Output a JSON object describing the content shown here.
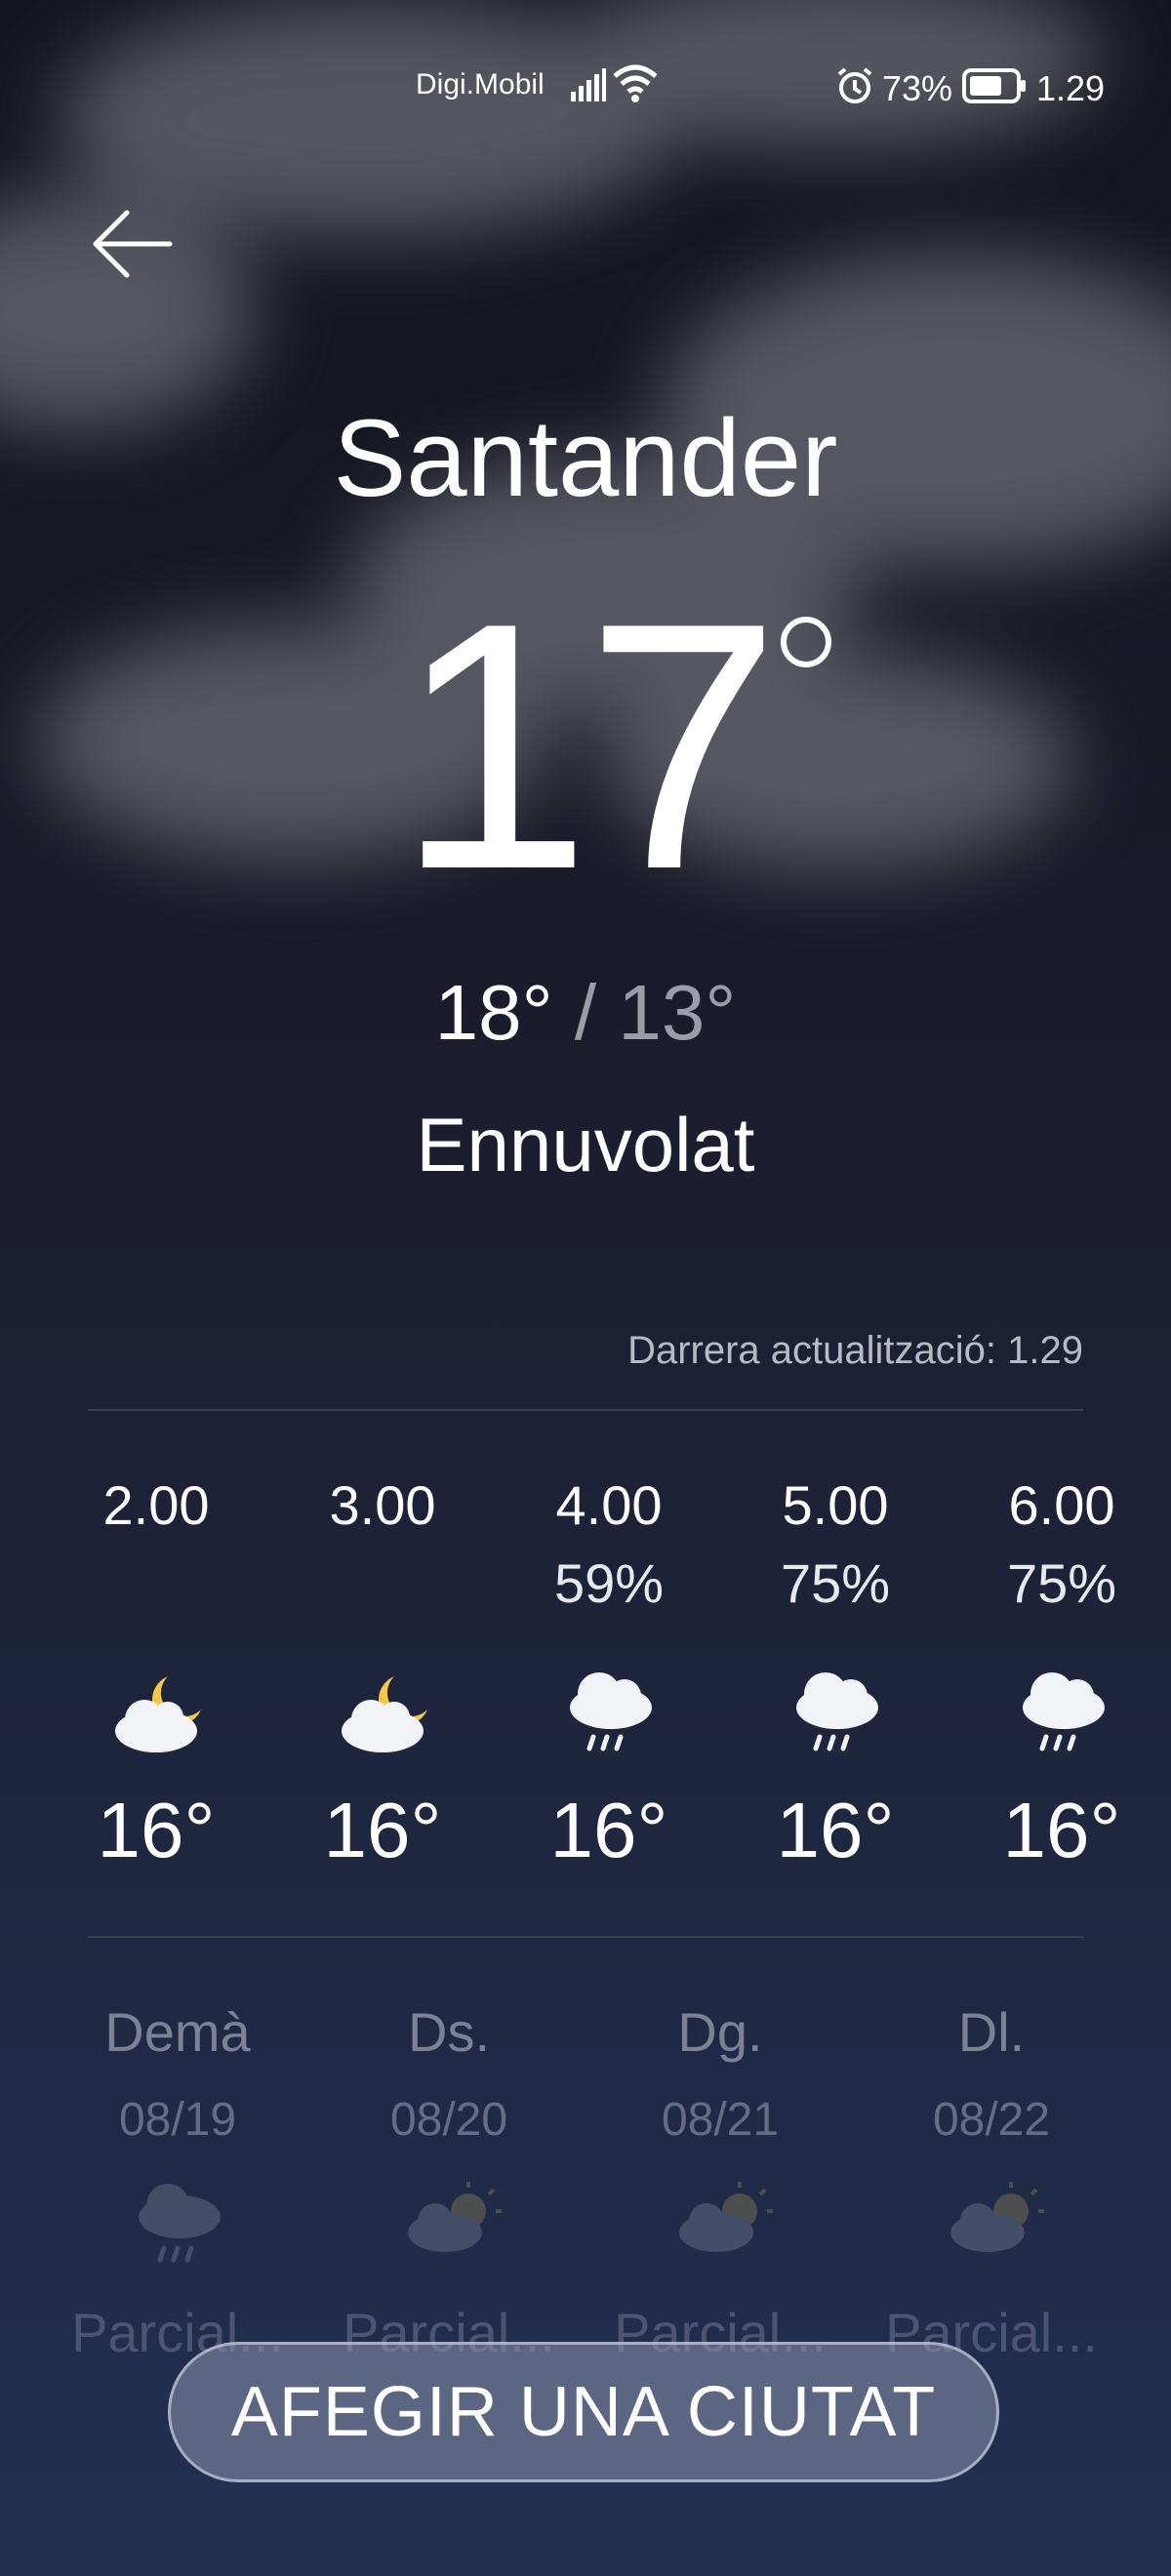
{
  "status_bar": {
    "carrier": "Digi.Mobil",
    "battery_percent": "73%",
    "time": "1.29"
  },
  "header": {
    "city": "Santander"
  },
  "current": {
    "temperature": "17",
    "high": "18°",
    "separator": "/",
    "low": "13°",
    "condition": "Ennuvolat",
    "last_update": "Darrera actualització: 1.29"
  },
  "hourly": [
    {
      "time": "2.00",
      "precip": "",
      "icon": "moon-cloud-icon",
      "temp": "16°"
    },
    {
      "time": "3.00",
      "precip": "",
      "icon": "moon-cloud-icon",
      "temp": "16°"
    },
    {
      "time": "4.00",
      "precip": "59%",
      "icon": "rain-cloud-icon",
      "temp": "16°"
    },
    {
      "time": "5.00",
      "precip": "75%",
      "icon": "rain-cloud-icon",
      "temp": "16°"
    },
    {
      "time": "6.00",
      "precip": "75%",
      "icon": "rain-cloud-icon",
      "temp": "16°"
    }
  ],
  "daily": [
    {
      "day": "Demà",
      "date": "08/19",
      "icon": "rain-cloud-icon",
      "summary": "Parcial..."
    },
    {
      "day": "Ds.",
      "date": "08/20",
      "icon": "sun-cloud-icon",
      "summary": "Parcial..."
    },
    {
      "day": "Dg.",
      "date": "08/21",
      "icon": "sun-cloud-icon",
      "summary": "Parcial..."
    },
    {
      "day": "Dl.",
      "date": "08/22",
      "icon": "sun-cloud-icon",
      "summary": "Parcial..."
    }
  ],
  "add_city_button": "AFEGIR UNA CIUTAT",
  "colors": {
    "background_top": "#15151f",
    "background_bottom": "#223052",
    "moon": "#f5c842",
    "secondary_text": "#9a9ca6"
  }
}
